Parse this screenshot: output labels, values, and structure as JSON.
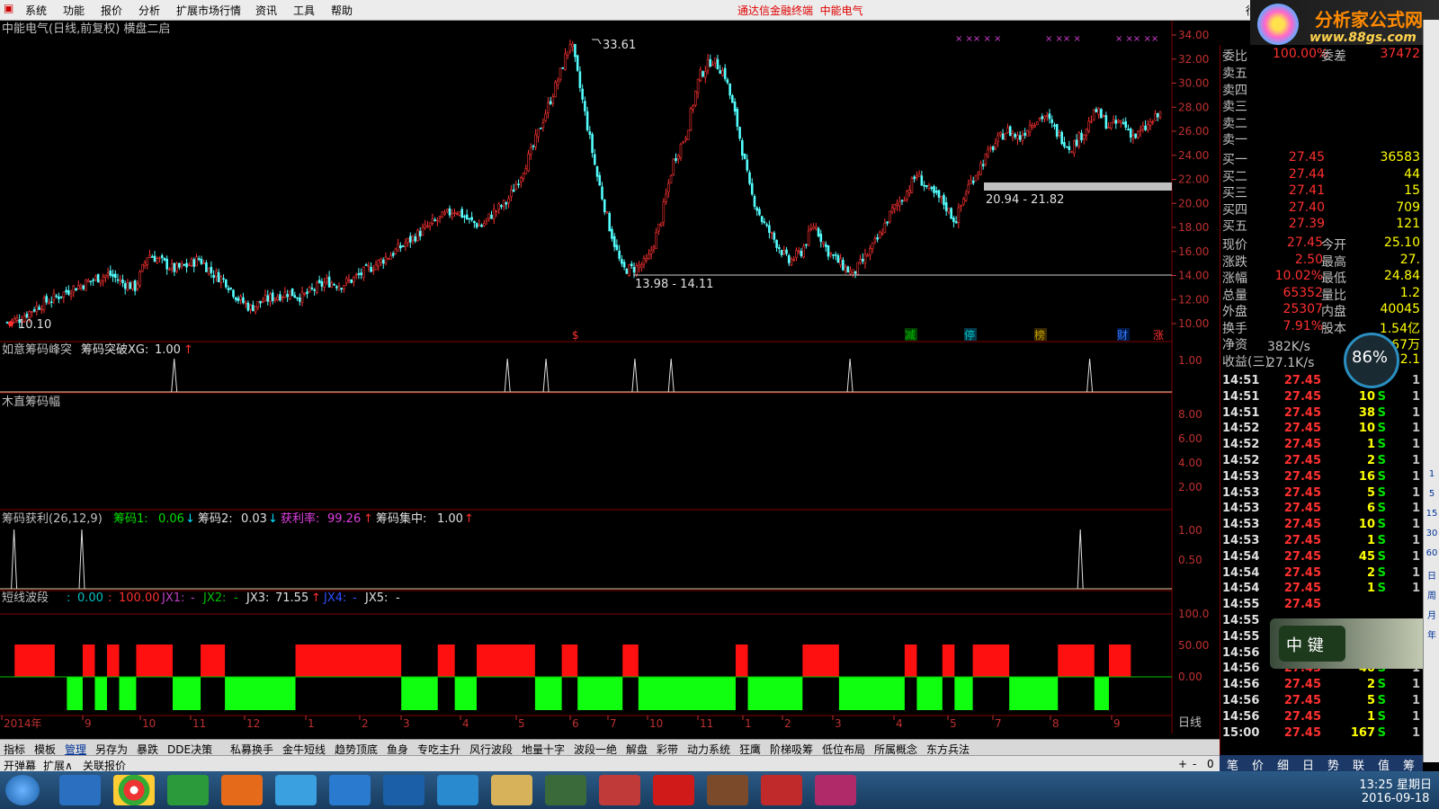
{
  "menu": {
    "items": [
      "系统",
      "功能",
      "报价",
      "分析",
      "扩展市场行情",
      "资讯",
      "工具",
      "帮助"
    ],
    "app_title": "通达信金融终端",
    "stock_name": "中能电气",
    "right_tab": "行"
  },
  "logo": {
    "line1": "分析家公式网",
    "line2": "www.88gs.com"
  },
  "main_title": "中能电气(日线,前复权) 横盘二启",
  "price_axis": [
    "34.00",
    "32.00",
    "30.00",
    "28.00",
    "26.00",
    "24.00",
    "22.00",
    "20.00",
    "18.00",
    "16.00",
    "14.00",
    "12.00",
    "10.00"
  ],
  "annotations": {
    "high": "33.61",
    "low": "10.10",
    "range1": "13.98 - 14.11",
    "range2": "20.94 - 21.82"
  },
  "event_marks": [
    {
      "text": "$",
      "color": "#ff3030"
    },
    {
      "text": "减",
      "color": "#00c000"
    },
    {
      "text": "停",
      "color": "#00c0c0"
    },
    {
      "text": "榜",
      "color": "#c0a000"
    },
    {
      "text": "财",
      "color": "#3a7aff"
    },
    {
      "text": "涨",
      "color": "#ff3030"
    }
  ],
  "panel1": {
    "title": "如意筹码峰突",
    "label": "筹码突破XG:",
    "value": "1.00",
    "axis": [
      "1.00"
    ]
  },
  "panel2": {
    "title": "木直筹码幅",
    "axis": [
      "8.00",
      "6.00",
      "4.00",
      "2.00"
    ]
  },
  "panel3": {
    "title": "筹码获利(26,12,9)",
    "items": [
      {
        "label": "筹码1:",
        "value": "0.06",
        "color": "#00e000"
      },
      {
        "label": "筹码2:",
        "value": "0.03",
        "color": "#e0e0e0"
      },
      {
        "label": "获利率:",
        "value": "99.26",
        "color": "#e040e0"
      },
      {
        "label": "筹码集中:",
        "value": "1.00",
        "color": "#e0e0e0"
      }
    ],
    "axis": [
      "1.00",
      "0.50"
    ]
  },
  "panel4": {
    "title": "短线波段",
    "items": [
      {
        "label": ":",
        "value": "0.00",
        "color": "#00c0c0"
      },
      {
        "label": ":",
        "value": "100.00",
        "color": "#ff3030"
      },
      {
        "label": "JX1:",
        "value": "-",
        "color": "#c040c0"
      },
      {
        "label": "JX2:",
        "value": "-",
        "color": "#00c000"
      },
      {
        "label": "JX3:",
        "value": "71.55",
        "color": "#e0e0e0"
      },
      {
        "label": "JX4:",
        "value": "-",
        "color": "#3050ff"
      },
      {
        "label": "JX5:",
        "value": "-",
        "color": "#e0e0e0"
      }
    ],
    "axis": [
      "100.0",
      "50.00",
      "0.00"
    ]
  },
  "time_axis": [
    "2014年",
    "9",
    "10",
    "11",
    "12",
    "1",
    "2",
    "3",
    "4",
    "5",
    "6",
    "7",
    "10",
    "11",
    "1",
    "2",
    "3",
    "4",
    "5",
    "7",
    "8",
    "9"
  ],
  "period_label": "日线",
  "bottom_tabs": [
    "指标",
    "模板",
    "管理",
    "另存为",
    "暴跌",
    "DDE决策",
    "私募换手",
    "金牛短线",
    "趋势顶底",
    "鱼身",
    "专吃主升",
    "风行波段",
    "地量十字",
    "波段一绝",
    "解盘",
    "彩带",
    "动力系统",
    "狂鹰",
    "阶梯吸筹",
    "低位布局",
    "所属概念",
    "东方兵法"
  ],
  "bottom_tabs2": [
    "开弹幕",
    "扩展∧",
    "关联报价"
  ],
  "scroll_btns": [
    "+",
    "-",
    "0"
  ],
  "quote": {
    "weibi_label": "委比",
    "weibi": "100.00%",
    "weicha_label": "委差",
    "weicha": "37472",
    "sells": [
      {
        "label": "卖五"
      },
      {
        "label": "卖四"
      },
      {
        "label": "卖三"
      },
      {
        "label": "卖二"
      },
      {
        "label": "卖一"
      }
    ],
    "buys": [
      {
        "label": "买一",
        "price": "27.45",
        "vol": "36583"
      },
      {
        "label": "买二",
        "price": "27.44",
        "vol": "44"
      },
      {
        "label": "买三",
        "price": "27.41",
        "vol": "15"
      },
      {
        "label": "买四",
        "price": "27.40",
        "vol": "709"
      },
      {
        "label": "买五",
        "price": "27.39",
        "vol": "121"
      }
    ],
    "stats": [
      {
        "l1": "现价",
        "v1": "27.45",
        "l2": "今开",
        "v2": "25.10"
      },
      {
        "l1": "涨跌",
        "v1": "2.50",
        "l2": "最高",
        "v2": "27."
      },
      {
        "l1": "涨幅",
        "v1": "10.02%",
        "l2": "最低",
        "v2": "24.84"
      },
      {
        "l1": "总量",
        "v1": "65352",
        "l2": "量比",
        "v2": "1.2"
      },
      {
        "l1": "外盘",
        "v1": "25307",
        "l2": "内盘",
        "v2": "40045"
      },
      {
        "l1": "换手",
        "v1": "7.91%",
        "l2": "股本",
        "v2": "1.54亿"
      },
      {
        "l1": "净资",
        "v1": "",
        "l2": "",
        "v2": "267万"
      },
      {
        "l1": "收益(三)",
        "v1": "",
        "l2": "",
        "v2": "72.1"
      }
    ],
    "gauge": "86%",
    "speed_up": "382K/s",
    "speed_down": "27.1K/s",
    "ticks": [
      {
        "t": "14:51",
        "p": "27.45",
        "v": "25",
        "s": "S",
        "n": "1"
      },
      {
        "t": "14:51",
        "p": "27.45",
        "v": "10",
        "s": "S",
        "n": "1"
      },
      {
        "t": "14:51",
        "p": "27.45",
        "v": "38",
        "s": "S",
        "n": "1"
      },
      {
        "t": "14:52",
        "p": "27.45",
        "v": "10",
        "s": "S",
        "n": "1"
      },
      {
        "t": "14:52",
        "p": "27.45",
        "v": "1",
        "s": "S",
        "n": "1"
      },
      {
        "t": "14:52",
        "p": "27.45",
        "v": "2",
        "s": "S",
        "n": "1"
      },
      {
        "t": "14:53",
        "p": "27.45",
        "v": "16",
        "s": "S",
        "n": "1"
      },
      {
        "t": "14:53",
        "p": "27.45",
        "v": "5",
        "s": "S",
        "n": "1"
      },
      {
        "t": "14:53",
        "p": "27.45",
        "v": "6",
        "s": "S",
        "n": "1"
      },
      {
        "t": "14:53",
        "p": "27.45",
        "v": "10",
        "s": "S",
        "n": "1"
      },
      {
        "t": "14:53",
        "p": "27.45",
        "v": "1",
        "s": "S",
        "n": "1"
      },
      {
        "t": "14:54",
        "p": "27.45",
        "v": "45",
        "s": "S",
        "n": "1"
      },
      {
        "t": "14:54",
        "p": "27.45",
        "v": "2",
        "s": "S",
        "n": "1"
      },
      {
        "t": "14:54",
        "p": "27.45",
        "v": "1",
        "s": "S",
        "n": "1"
      },
      {
        "t": "14:55",
        "p": "27.45",
        "v": "",
        "s": "",
        "n": ""
      },
      {
        "t": "14:55",
        "p": "",
        "v": "",
        "s": "",
        "n": ""
      },
      {
        "t": "14:55",
        "p": "",
        "v": "",
        "s": "",
        "n": ""
      },
      {
        "t": "14:56",
        "p": "",
        "v": "",
        "s": "",
        "n": ""
      },
      {
        "t": "14:56",
        "p": "27.45",
        "v": "40",
        "s": "S",
        "n": "1"
      },
      {
        "t": "14:56",
        "p": "27.45",
        "v": "2",
        "s": "S",
        "n": "1"
      },
      {
        "t": "14:56",
        "p": "27.45",
        "v": "5",
        "s": "S",
        "n": "1"
      },
      {
        "t": "14:56",
        "p": "27.45",
        "v": "1",
        "s": "S",
        "n": "1"
      },
      {
        "t": "15:00",
        "p": "27.45",
        "v": "167",
        "s": "S",
        "n": "1"
      }
    ]
  },
  "zhongjian": "中 键",
  "panel_tabs": [
    "笔",
    "价",
    "细",
    "日",
    "势",
    "联",
    "值",
    "筹"
  ],
  "right_strip": [
    "1",
    "5",
    "15",
    "30",
    "60",
    "日",
    "周",
    "月",
    "年"
  ],
  "clock": {
    "time": "13:25 星期日",
    "date": "2016-09-18"
  },
  "chart_data": {
    "type": "candlestick",
    "title": "中能电气(日线,前复权) 横盘二启",
    "ylim": [
      10,
      34
    ],
    "price_path": [
      10.1,
      10.4,
      11.2,
      11.8,
      12.3,
      12.9,
      13.3,
      13.8,
      14.1,
      13.4,
      13.0,
      15.8,
      15.2,
      14.5,
      14.8,
      15.4,
      14.2,
      13.6,
      12.1,
      11.3,
      11.9,
      12.3,
      12.6,
      12.2,
      12.9,
      13.5,
      13.2,
      13.7,
      14.4,
      15.1,
      15.8,
      16.6,
      17.4,
      18.2,
      18.9,
      19.5,
      18.6,
      18.1,
      19.3,
      20.1,
      22.2,
      24.5,
      27.5,
      30.3,
      33.6,
      28.0,
      22.5,
      18.1,
      14.5,
      14.6,
      15.2,
      18.5,
      23.5,
      25.8,
      30.5,
      32.0,
      30.8,
      26.5,
      21.0,
      18.4,
      16.8,
      15.1,
      16.0,
      18.3,
      16.1,
      15.0,
      14.1,
      15.5,
      17.1,
      19.3,
      20.6,
      22.4,
      21.0,
      20.2,
      18.5,
      21.4,
      23.2,
      24.8,
      26.1,
      25.4,
      26.8,
      27.3,
      25.8,
      24.6,
      25.9,
      27.7,
      26.4,
      26.8,
      25.5,
      26.4,
      27.45
    ],
    "signals": {
      "breakout": [
        0.149,
        0.434,
        0.467,
        0.543,
        0.574,
        0.727,
        0.932
      ],
      "profit_spikes": [
        0.012,
        0.07,
        0.924
      ]
    },
    "bands": [
      [
        "r",
        0.012,
        0.045
      ],
      [
        "g",
        0.055,
        0.068
      ],
      [
        "r",
        0.068,
        0.078
      ],
      [
        "g",
        0.078,
        0.088
      ],
      [
        "r",
        0.088,
        0.098
      ],
      [
        "g",
        0.098,
        0.112
      ],
      [
        "r",
        0.112,
        0.142
      ],
      [
        "g",
        0.142,
        0.165
      ],
      [
        "r",
        0.165,
        0.185
      ],
      [
        "g",
        0.185,
        0.243
      ],
      [
        "r",
        0.243,
        0.33
      ],
      [
        "g",
        0.33,
        0.36
      ],
      [
        "r",
        0.36,
        0.374
      ],
      [
        "g",
        0.374,
        0.392
      ],
      [
        "r",
        0.392,
        0.44
      ],
      [
        "g",
        0.44,
        0.462
      ],
      [
        "r",
        0.462,
        0.475
      ],
      [
        "g",
        0.475,
        0.512
      ],
      [
        "r",
        0.512,
        0.525
      ],
      [
        "g",
        0.525,
        0.605
      ],
      [
        "r",
        0.605,
        0.615
      ],
      [
        "g",
        0.615,
        0.66
      ],
      [
        "r",
        0.66,
        0.69
      ],
      [
        "g",
        0.69,
        0.744
      ],
      [
        "r",
        0.744,
        0.754
      ],
      [
        "g",
        0.754,
        0.775
      ],
      [
        "r",
        0.775,
        0.785
      ],
      [
        "g",
        0.785,
        0.8
      ],
      [
        "r",
        0.8,
        0.83
      ],
      [
        "g",
        0.83,
        0.87
      ],
      [
        "r",
        0.87,
        0.9
      ],
      [
        "g",
        0.9,
        0.912
      ],
      [
        "r",
        0.912,
        0.93
      ]
    ]
  }
}
